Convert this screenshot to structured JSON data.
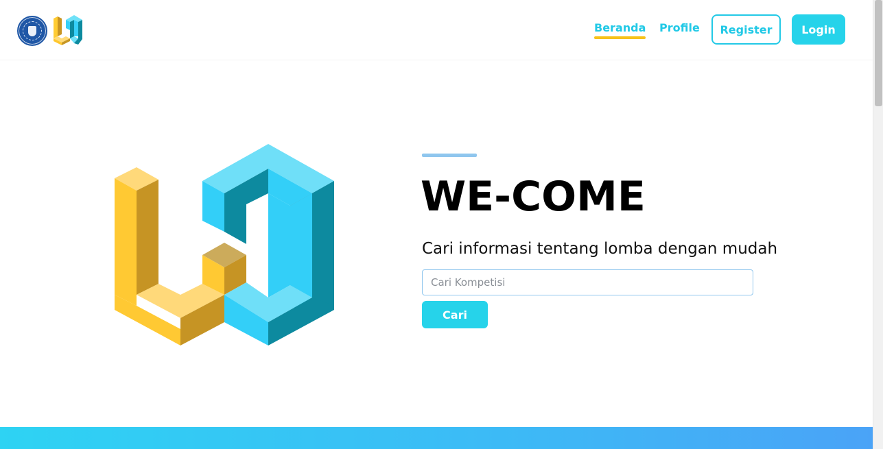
{
  "header": {
    "nav": [
      {
        "label": "Beranda",
        "active": true
      },
      {
        "label": "Profile",
        "active": false
      }
    ],
    "register_label": "Register",
    "login_label": "Login"
  },
  "hero": {
    "title": "WE-COME",
    "subtitle": "Cari informasi tentang lomba dengan mudah",
    "search_placeholder": "Cari Kompetisi",
    "search_value": "",
    "search_button": "Cari"
  },
  "colors": {
    "accent": "#22c9e6",
    "button": "#26d3ea",
    "underline": "#f7c21a",
    "logo_yellow": "#ffc933",
    "logo_blue": "#33cff8"
  }
}
